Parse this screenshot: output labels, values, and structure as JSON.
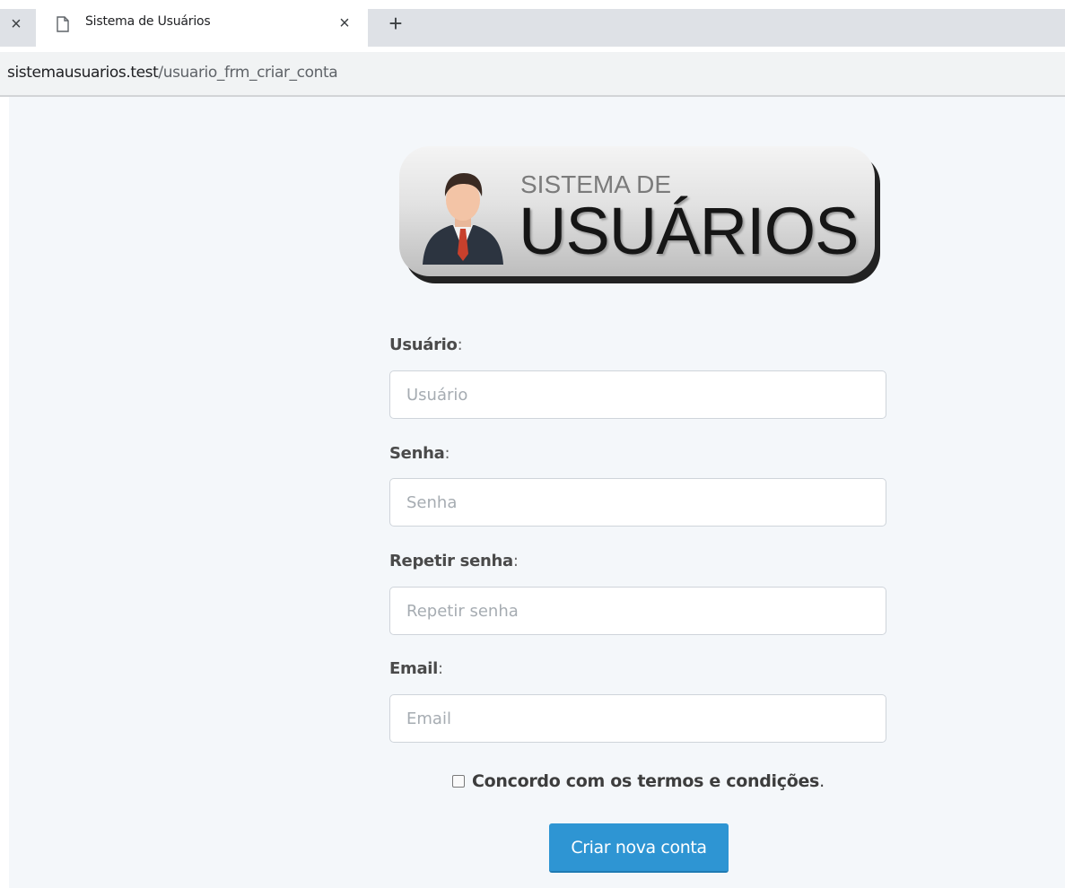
{
  "browser": {
    "tab_title": "Sistema de Usuários",
    "url_host": "sistemausuarios.test",
    "url_path": "/usuario_frm_criar_conta",
    "icons": {
      "prev_tab_close": "close-icon",
      "tab_document": "document-icon",
      "tab_close": "close-icon",
      "new_tab": "plus-icon"
    },
    "close_glyph": "×",
    "new_tab_glyph": "+"
  },
  "logo": {
    "line1": "SISTEMA DE",
    "line2": "USUÁRIOS"
  },
  "form": {
    "fields": [
      {
        "label": "Usuário",
        "placeholder": "Usuário",
        "value": ""
      },
      {
        "label": "Senha",
        "placeholder": "Senha",
        "value": ""
      },
      {
        "label": "Repetir senha",
        "placeholder": "Repetir senha",
        "value": ""
      },
      {
        "label": "Email",
        "placeholder": "Email",
        "value": ""
      }
    ],
    "label_suffix": ":",
    "terms_label": "Concordo com os termos e condições",
    "terms_suffix": ".",
    "terms_checked": false,
    "submit_label": "Criar nova conta"
  },
  "colors": {
    "page_background": "#f4f7fa",
    "primary_button": "#2e95d3"
  }
}
